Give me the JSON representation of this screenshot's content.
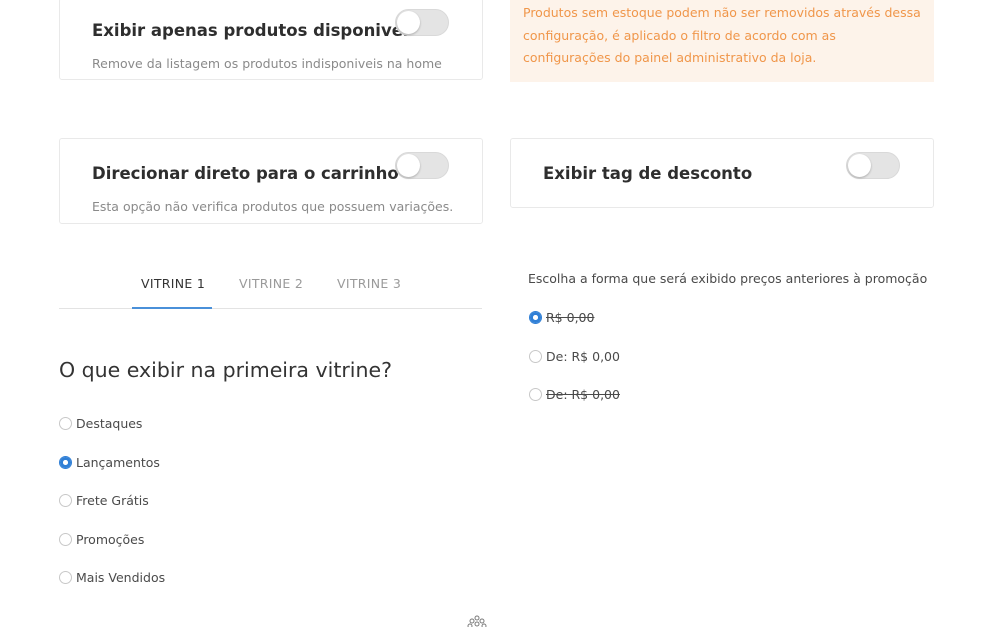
{
  "cards": {
    "available_products": {
      "title": "Exibir apenas produtos disponiveis",
      "description": "Remove da listagem os produtos indisponiveis na home",
      "toggle_on": false
    },
    "direct_to_cart": {
      "title": "Direcionar direto para o carrinho",
      "description": "Esta opção não verifica produtos que possuem variações.",
      "toggle_on": false
    },
    "discount_tag": {
      "title": "Exibir tag de desconto",
      "toggle_on": false
    }
  },
  "alert": {
    "text": "Produtos sem estoque podem não ser removidos através dessa configuração, é aplicado o filtro de acordo com as configurações do painel administrativo da loja.",
    "color": "#f0964a",
    "background": "#fdf3ea"
  },
  "tabs": [
    {
      "label": "VITRINE 1",
      "active": true
    },
    {
      "label": "VITRINE 2",
      "active": false
    },
    {
      "label": "VITRINE 3",
      "active": false
    }
  ],
  "showcase": {
    "heading": "O que exibir na primeira vitrine?",
    "options": [
      {
        "label": "Destaques",
        "checked": false
      },
      {
        "label": "Lançamentos",
        "checked": true
      },
      {
        "label": "Frete Grátis",
        "checked": false
      },
      {
        "label": "Promoções",
        "checked": false
      },
      {
        "label": "Mais Vendidos",
        "checked": false
      }
    ]
  },
  "price_format": {
    "prompt": "Escolha a forma que será exibido preços anteriores à promoção",
    "options": [
      {
        "label": "R$ 0,00",
        "checked": true,
        "strikethrough": true
      },
      {
        "label": "De: R$ 0,00",
        "checked": false,
        "strikethrough": false
      },
      {
        "label": "De: R$ 0,00",
        "checked": false,
        "strikethrough": true
      }
    ]
  },
  "colors": {
    "accent": "#2f7fd6",
    "tab_underline": "#4a90d9"
  },
  "icons": {
    "loader": "loading-spinner-icon"
  }
}
